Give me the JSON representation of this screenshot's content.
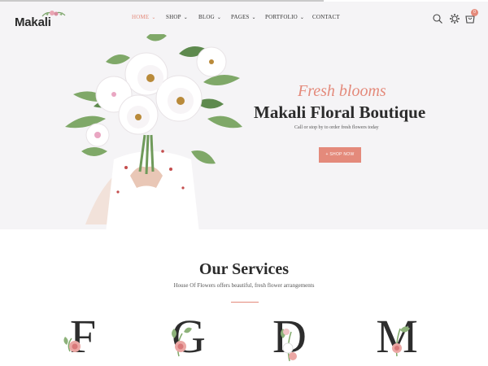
{
  "brand": {
    "name": "Makali"
  },
  "nav": {
    "items": [
      {
        "label": "HOME",
        "has_dropdown": true,
        "active": true
      },
      {
        "label": "SHOP",
        "has_dropdown": true
      },
      {
        "label": "BLOG",
        "has_dropdown": true
      },
      {
        "label": "PAGES",
        "has_dropdown": true
      },
      {
        "label": "PORTFOLIO",
        "has_dropdown": true
      },
      {
        "label": "CONTACT",
        "has_dropdown": false
      }
    ]
  },
  "header_icons": [
    "search-icon",
    "gear-icon",
    "cart-icon"
  ],
  "cart": {
    "count": "0"
  },
  "hero": {
    "subtitle": "Fresh blooms",
    "title": "Makali Floral Boutique",
    "description": "Call or stop by to order fresh flowers today",
    "button_label": "+ SHOP NOW"
  },
  "services": {
    "title": "Our Services",
    "subtitle": "House Of Flowers offers beautiful, fresh flower arrangements",
    "letters": [
      "F",
      "G",
      "D",
      "M"
    ]
  },
  "colors": {
    "accent": "#e48a7b",
    "hero_bg": "#f5f4f6",
    "text": "#2b2b2b"
  }
}
